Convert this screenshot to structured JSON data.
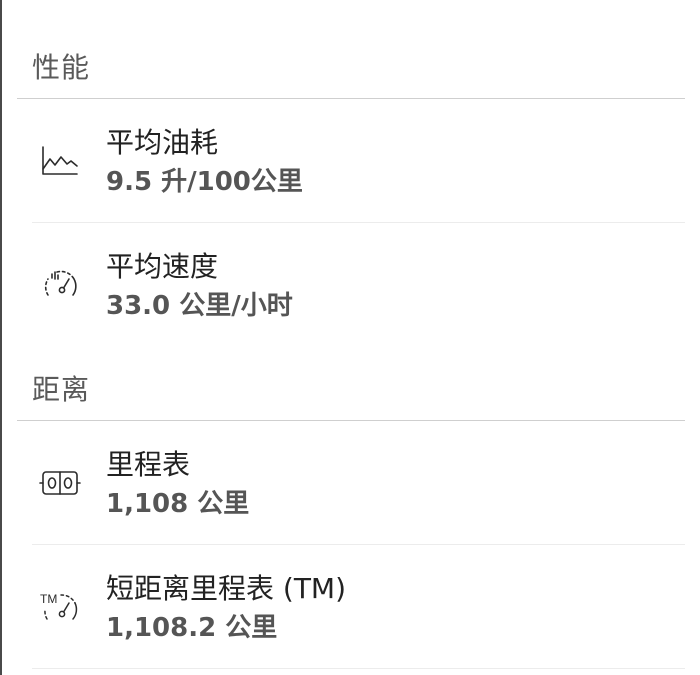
{
  "sections": [
    {
      "title": "性能",
      "items": [
        {
          "icon": "chart-icon",
          "label": "平均油耗",
          "value": "9.5 升/100公里"
        },
        {
          "icon": "speedometer-icon",
          "label": "平均速度",
          "value": "33.0 公里/小时"
        }
      ]
    },
    {
      "title": "距离",
      "items": [
        {
          "icon": "odometer-icon",
          "label": "里程表",
          "value": "1,108 公里"
        },
        {
          "icon": "trip-meter-icon",
          "label": "短距离里程表 (TM)",
          "value": "1,108.2 公里"
        }
      ]
    }
  ]
}
